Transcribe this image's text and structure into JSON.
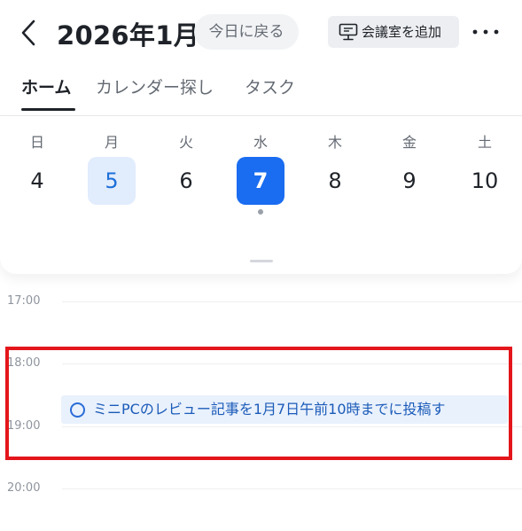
{
  "header": {
    "month_title": "2026年1月",
    "today_label": "今日に戻る",
    "add_room_label": "会議室を追加",
    "more_label": "•••"
  },
  "tabs": [
    {
      "label": "ホーム",
      "active": true
    },
    {
      "label": "カレンダー探し",
      "active": false
    },
    {
      "label": "タスク",
      "active": false
    }
  ],
  "week": {
    "days": [
      {
        "weekday": "日",
        "date": "4",
        "state": "normal"
      },
      {
        "weekday": "月",
        "date": "5",
        "state": "today"
      },
      {
        "weekday": "火",
        "date": "6",
        "state": "normal"
      },
      {
        "weekday": "水",
        "date": "7",
        "state": "selected",
        "has_event": true
      },
      {
        "weekday": "木",
        "date": "8",
        "state": "normal"
      },
      {
        "weekday": "金",
        "date": "9",
        "state": "normal"
      },
      {
        "weekday": "土",
        "date": "10",
        "state": "normal"
      }
    ]
  },
  "timeline": {
    "hours": [
      "17:00",
      "18:00",
      "19:00",
      "20:00"
    ],
    "task": {
      "title": "ミニPCのレビュー記事を1月7日午前10時までに投稿す"
    }
  },
  "colors": {
    "accent": "#1a6cf0",
    "today_soft": "#e1ecfd",
    "task_bg": "#e9f1fd",
    "highlight": "#e3161b"
  },
  "icons": {
    "back": "chevron-left-icon",
    "add_room": "meeting-room-icon",
    "more": "more-horizontal-icon",
    "task": "task-circle-icon"
  }
}
